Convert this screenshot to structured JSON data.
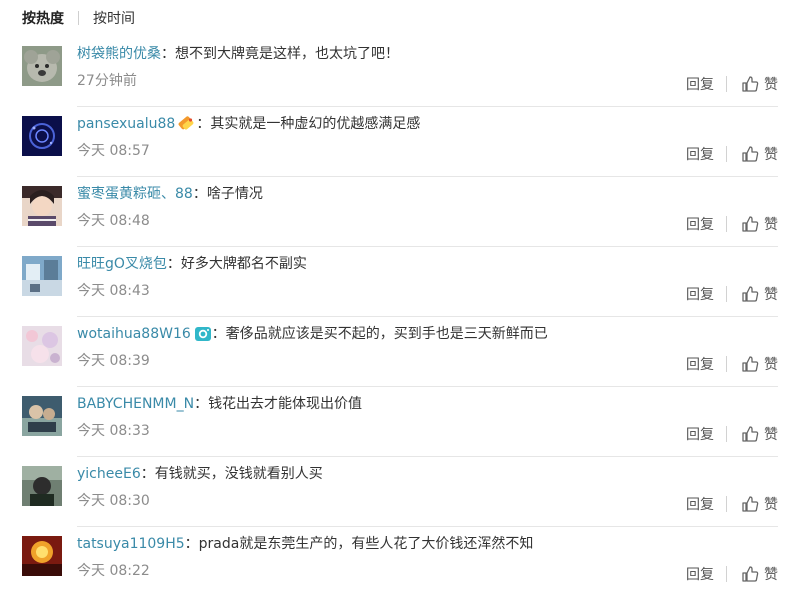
{
  "sort": {
    "hot_label": "按热度",
    "time_label": "按时间"
  },
  "actions": {
    "reply_label": "回复",
    "like_label": "赞"
  },
  "comments": [
    {
      "user": "树袋熊的优桑",
      "text": "想不到大牌竟是这样，也太坑了吧！",
      "time": "27分钟前",
      "badge": ""
    },
    {
      "user": "pansexualu88",
      "text": "其实就是一种虚幻的优越感满足感",
      "time": "今天 08:57",
      "badge": "vip-badge-icon"
    },
    {
      "user": "蜜枣蛋黄粽砸、88",
      "text": "啥子情况",
      "time": "今天 08:48",
      "badge": ""
    },
    {
      "user": "旺旺gO叉烧包",
      "text": "好多大牌都名不副实",
      "time": "今天 08:43",
      "badge": ""
    },
    {
      "user": "wotaihua88W16",
      "text": "奢侈品就应该是买不起的，买到手也是三天新鲜而已",
      "time": "今天 08:39",
      "badge": "camera-badge-icon"
    },
    {
      "user": "BABYCHENMM_N",
      "text": "钱花出去才能体现出价值",
      "time": "今天 08:33",
      "badge": ""
    },
    {
      "user": "yicheeE6",
      "text": "有钱就买，没钱就看别人买",
      "time": "今天 08:30",
      "badge": ""
    },
    {
      "user": "tatsuya1109H5",
      "text": "prada就是东莞生产的，有些人花了大价钱还浑然不知",
      "time": "今天 08:22",
      "badge": ""
    }
  ]
}
